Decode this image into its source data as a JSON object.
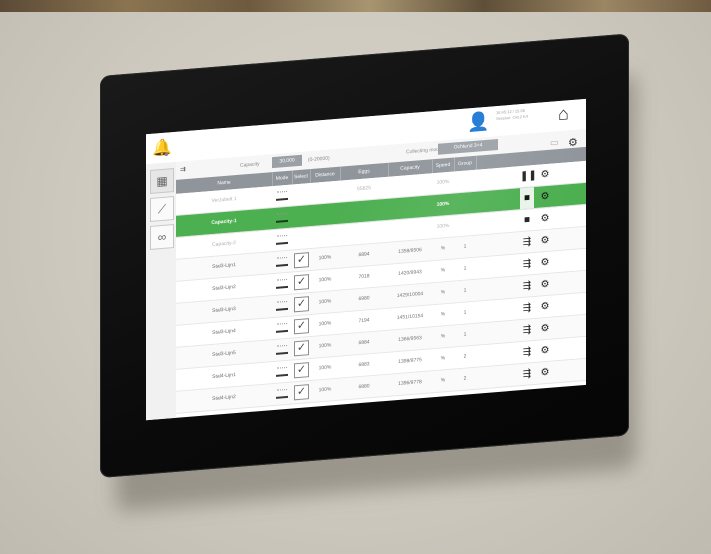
{
  "scene": {
    "wall_color": "#cfcbc0",
    "bezel_color": "#0b0b0b",
    "accent_green": "#4caf50",
    "header_gray": "#8f959b"
  },
  "topbar": {
    "icons": [
      "bell-icon",
      "user-icon",
      "home-icon"
    ],
    "clock_line1": "16:45:12 / 15.05",
    "clock_line2": "Session: Ost.2 K4"
  },
  "infobar": {
    "capacity_label": "Capacity",
    "capacity_value": "30,000",
    "capacity_unit": "(0-20000)",
    "collecting_label": "Collecting mode",
    "collecting_value": "Ochtend 3+4"
  },
  "columns": [
    "Name",
    "Mode",
    "Select",
    "Distance",
    "Eggs",
    "Capacity",
    "Speed",
    "Group"
  ],
  "rows": [
    {
      "name": "Verzubelt 1",
      "distance": "",
      "eggs": "55625",
      "capacity": "",
      "speed": "100%",
      "group": "",
      "action": "pause",
      "style": "light"
    },
    {
      "name": "Capacity-1",
      "distance": "",
      "eggs": "",
      "capacity": "",
      "speed": "100%",
      "group": "",
      "action": "stop",
      "style": "green"
    },
    {
      "name": "Capacity-2",
      "distance": "",
      "eggs": "",
      "capacity": "",
      "speed": "100%",
      "group": "",
      "action": "stop",
      "style": "light"
    },
    {
      "name": "Stal3-Lijn1",
      "distance": "100%",
      "eggs": "6894",
      "capacity": "1358/9506",
      "speed": "%",
      "group": "1",
      "action": "run",
      "style": "normal"
    },
    {
      "name": "Stal3-Lijn2",
      "distance": "100%",
      "eggs": "7018",
      "capacity": "1420/9943",
      "speed": "%",
      "group": "1",
      "action": "run",
      "style": "normal"
    },
    {
      "name": "Stal3-Lijn3",
      "distance": "100%",
      "eggs": "6980",
      "capacity": "1429/10004",
      "speed": "%",
      "group": "1",
      "action": "run",
      "style": "normal"
    },
    {
      "name": "Stal3-Lijn4",
      "distance": "100%",
      "eggs": "7194",
      "capacity": "1451/10154",
      "speed": "%",
      "group": "1",
      "action": "run",
      "style": "normal"
    },
    {
      "name": "Stal3-Lijn5",
      "distance": "100%",
      "eggs": "6884",
      "capacity": "1366/9563",
      "speed": "%",
      "group": "1",
      "action": "run",
      "style": "normal"
    },
    {
      "name": "Stal4-Lijn1",
      "distance": "100%",
      "eggs": "6883",
      "capacity": "1398/9775",
      "speed": "%",
      "group": "2",
      "action": "run",
      "style": "normal"
    },
    {
      "name": "Stal4-Lijn2",
      "distance": "100%",
      "eggs": "6880",
      "capacity": "1396/9778",
      "speed": "%",
      "group": "2",
      "action": "run",
      "style": "normal"
    }
  ]
}
